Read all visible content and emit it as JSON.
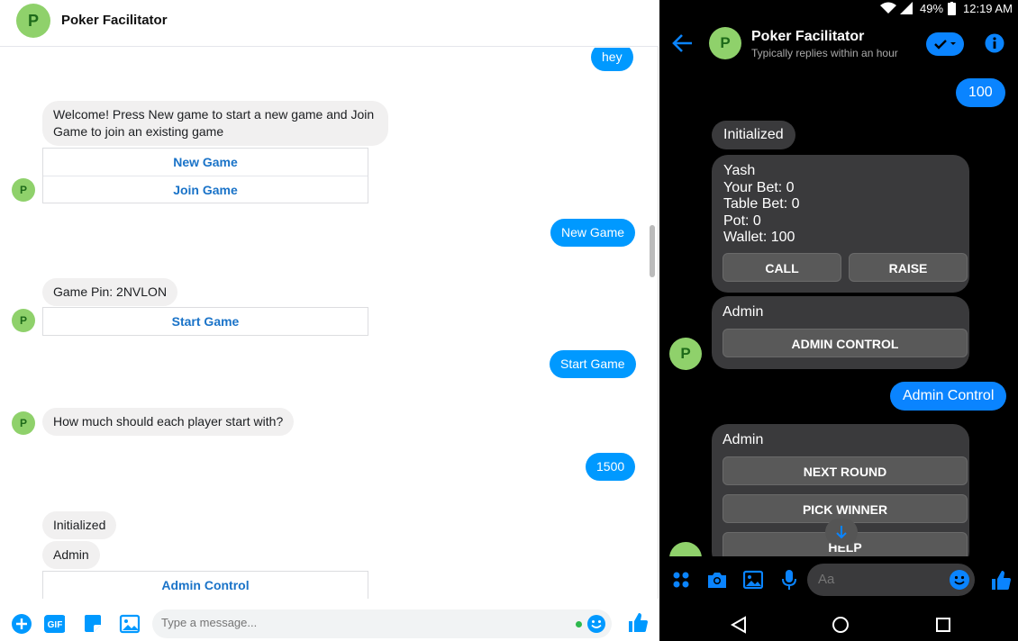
{
  "desktop": {
    "header": {
      "title": "Poker Facilitator",
      "avatar_letter": "P"
    },
    "messages": {
      "hey": "hey",
      "welcome": "Welcome! Press New game to start a new game and Join Game to join an existing game",
      "btn_new_game": "New Game",
      "btn_join_game": "Join Game",
      "out_new_game": "New Game",
      "game_pin": "Game Pin: 2NVLON",
      "btn_start_game": "Start Game",
      "out_start_game": "Start Game",
      "start_question": "How much should each player start with?",
      "out_1500": "1500",
      "initialized": "Initialized",
      "admin": "Admin",
      "btn_admin_control": "Admin Control"
    },
    "footer": {
      "input_placeholder": "Type a message...",
      "gif_label": "GIF"
    }
  },
  "mobile": {
    "status": {
      "battery": "49%",
      "time": "12:19 AM"
    },
    "header": {
      "title": "Poker Facilitator",
      "subtitle": "Typically replies within an hour",
      "avatar_letter": "P"
    },
    "messages": {
      "out_100": "100",
      "initialized": "Initialized",
      "player_name": "Yash",
      "your_bet": "Your Bet: 0",
      "table_bet": "Table Bet: 0",
      "pot": "Pot: 0",
      "wallet": "Wallet: 100",
      "btn_call": "CALL",
      "btn_raise": "RAISE",
      "admin_1": "Admin",
      "btn_admin_control": "ADMIN CONTROL",
      "out_admin_control": "Admin Control",
      "admin_2": "Admin",
      "btn_next_round": "NEXT ROUND",
      "btn_pick_winner": "PICK WINNER",
      "btn_help": "HELP"
    },
    "footer": {
      "input_placeholder": "Aa"
    }
  },
  "colors": {
    "messenger_blue": "#0099ff",
    "avatar_green": "#8fd16b",
    "mobile_bubble": "#3a3a3c"
  }
}
